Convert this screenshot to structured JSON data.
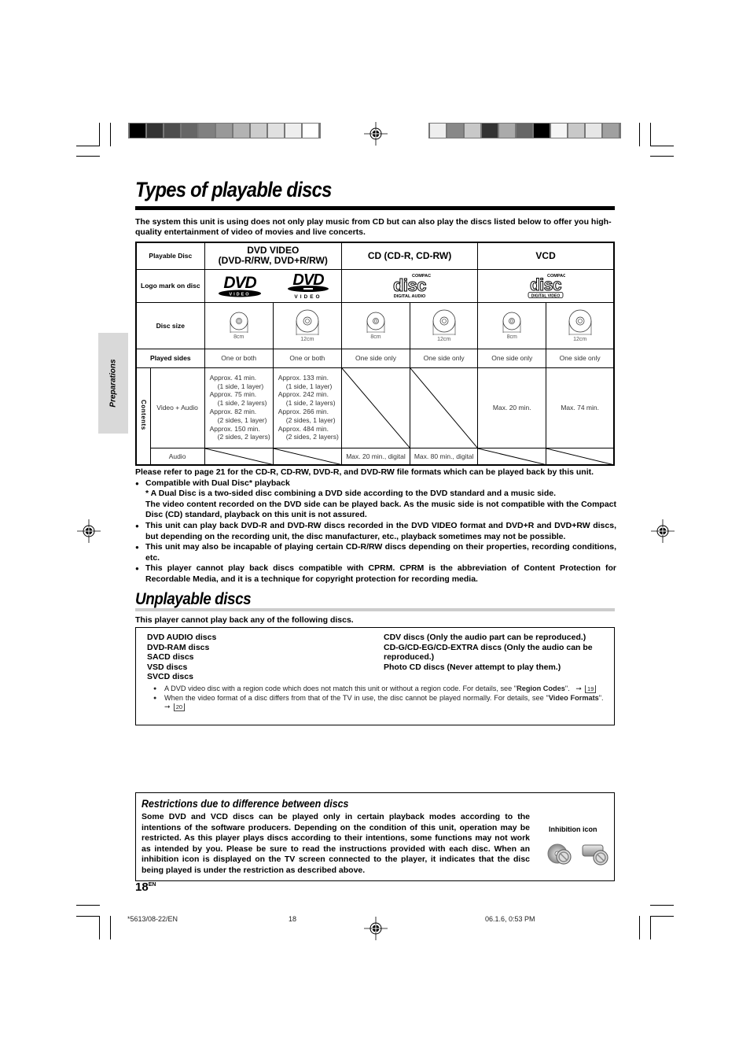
{
  "color_bars": {
    "left": [
      "#000000",
      "#333333",
      "#4d4d4d",
      "#666666",
      "#808080",
      "#999999",
      "#b3b3b3",
      "#cccccc",
      "#e0e0e0",
      "#eeeeee",
      "#ffffff"
    ],
    "right": [
      "#eeeeee",
      "#888888",
      "#c8c8c8",
      "#333333",
      "#aaaaaa",
      "#666666",
      "#000000",
      "#f5f5f5",
      "#c8c8c8",
      "#e6e6e6",
      "#a0a0a0"
    ]
  },
  "side_tab": {
    "label": "Preparations"
  },
  "title": "Types of playable discs",
  "intro": "The system this unit is using does not only play music from CD but can also play the discs listed below to offer you high-quality entertainment of video of movies and live concerts.",
  "table": {
    "row_labels": {
      "playable_disc": "Playable Disc",
      "logo": "Logo mark on disc",
      "disc_size": "Disc size",
      "played_sides": "Played sides",
      "contents": "Contents",
      "video_audio": "Video + Audio",
      "audio": "Audio"
    },
    "groups": [
      {
        "name": "DVD VIDEO",
        "sub": "(DVD-R/RW, DVD+R/RW)"
      },
      {
        "name": "CD (CD-R, CD-RW)",
        "sub": ""
      },
      {
        "name": "VCD",
        "sub": ""
      }
    ],
    "logos": {
      "dvd_video_1": "VIDEO",
      "dvd_video_2": "VIDEO",
      "cd_top": "COMPACT",
      "cd_main": "disc",
      "cd_bottom": "DIGITAL AUDIO",
      "vcd_top": "COMPACT",
      "vcd_main": "disc",
      "vcd_bottom": "DIGITAL VIDEO"
    },
    "sizes": [
      "8cm",
      "12cm",
      "8cm",
      "12cm",
      "8cm",
      "12cm"
    ],
    "played_sides": [
      "One or both",
      "One or both",
      "One side only",
      "One side only",
      "One side only",
      "One side only"
    ],
    "video_audio": {
      "dvd_8cm": [
        {
          "t": "Approx. 41 min.",
          "ind": false
        },
        {
          "t": "(1 side, 1 layer)",
          "ind": true
        },
        {
          "t": "Approx. 75 min.",
          "ind": false
        },
        {
          "t": "(1 side, 2 layers)",
          "ind": true
        },
        {
          "t": "Approx. 82 min.",
          "ind": false
        },
        {
          "t": "(2 sides, 1 layer)",
          "ind": true
        },
        {
          "t": "Approx. 150 min.",
          "ind": false
        },
        {
          "t": "(2 sides, 2 layers)",
          "ind": true
        }
      ],
      "dvd_12cm": [
        {
          "t": "Approx. 133 min.",
          "ind": false
        },
        {
          "t": "(1 side, 1 layer)",
          "ind": true
        },
        {
          "t": "Approx. 242 min.",
          "ind": false
        },
        {
          "t": "(1 side, 2 layers)",
          "ind": true
        },
        {
          "t": "Approx. 266 min.",
          "ind": false
        },
        {
          "t": "(2 sides, 1 layer)",
          "ind": true
        },
        {
          "t": "Approx. 484 min.",
          "ind": false
        },
        {
          "t": "(2 sides, 2 layers)",
          "ind": true
        }
      ],
      "vcd_8cm": "Max. 20 min.",
      "vcd_12cm": "Max. 74 min."
    },
    "audio": {
      "cd_8cm": "Max. 20 min., digital",
      "cd_12cm": "Max. 80 min., digital"
    }
  },
  "notes": {
    "refer": "Please refer to page 21 for the CD-R, CD-RW, DVD-R, and DVD-RW file formats which can be played back by this unit.",
    "dual_disc_title": "Compatible with Dual Disc*  playback",
    "dual_disc_note": "* A Dual Disc is a two-sided disc combining a DVD side according to the DVD standard and a music side.",
    "dual_disc_detail": "The video content recorded on the DVD side can be played back. As the music side is not compatible with the Compact Disc (CD) standard, playback on this unit is not assured.",
    "bullets": [
      "This unit can play back DVD-R and DVD-RW discs recorded in the DVD VIDEO format and DVD+R and DVD+RW discs, but depending on the recording unit, the disc manufacturer, etc., playback sometimes may not be possible.",
      "This unit may also be incapable of playing certain CD-R/RW discs depending on their properties, recording conditions, etc.",
      "This player cannot play back discs compatible with CPRM. CPRM is the abbreviation of Content Protection for Recordable Media, and it is a technique for copyright protection for recording media."
    ]
  },
  "unplayable": {
    "title": "Unplayable discs",
    "intro": "This player cannot play back any of the following discs.",
    "left": [
      "DVD AUDIO discs",
      "DVD-RAM discs",
      "SACD discs",
      "VSD discs",
      "SVCD discs"
    ],
    "right": [
      "CDV discs (Only the audio part can be reproduced.)",
      "CD-G/CD-EG/CD-EXTRA discs (Only the audio can be reproduced.)",
      "Photo CD discs (Never attempt to play them.)"
    ],
    "bullets": [
      {
        "pre": "A DVD video disc with a region code which does not match this unit or without a region code. For details, see \"",
        "bold": "Region Codes",
        "post": "\".",
        "page": "19"
      },
      {
        "pre": "When the video format of a disc differs from that of the TV in use, the disc cannot be played normally. For details, see \"",
        "bold": "Video Formats",
        "post": "\".",
        "page": "20"
      }
    ]
  },
  "restrictions": {
    "title": "Restrictions due to difference between discs",
    "text": "Some DVD and VCD discs can be played only in certain playback modes according to the intentions of the software producers. Depending on the condition of this unit, operation may be restricted. As this player plays discs according to their intentions, some functions may not work as intended by you. Please be sure to read the instructions provided with each disc. When an inhibition icon is displayed on the TV screen connected to the player, it indicates that the disc being played is under the restriction as described above.",
    "icon_label": "Inhibition icon"
  },
  "page_number": "18",
  "page_lang": "EN",
  "footer": {
    "code": "*5613/08-22/EN",
    "page": "18",
    "datetime": "06.1.6, 0:53 PM"
  }
}
